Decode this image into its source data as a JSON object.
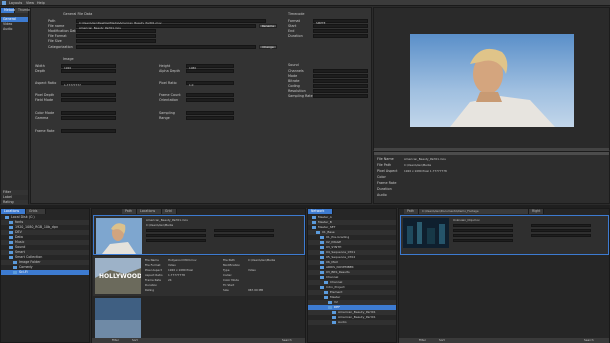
{
  "menubar": {
    "items": [
      "Layouts",
      "View",
      "Help"
    ]
  },
  "left_tabs": [
    "Metadata",
    "Thumbnails"
  ],
  "left_list": [
    "General",
    "Video",
    "Audio"
  ],
  "left_bottom": [
    "Filter",
    "Label",
    "Rating"
  ],
  "general": {
    "section": "General File Data",
    "labels": [
      "Path",
      "File name",
      "Modification Date",
      "File Format",
      "File Size",
      "Categorization"
    ],
    "values": [
      "C:\\Users\\dev\\Desktop\\Media\\American_Beauty_Part01.mov",
      "American_Beauty_Part01.mov",
      "",
      "",
      "",
      ""
    ],
    "button1": "Rename",
    "button2": "Change"
  },
  "image": {
    "section": "Image",
    "left_labels": [
      "Width",
      "Depth",
      "Aspect Ratio",
      "Pixel Depth",
      "Field Mode",
      "Color Mode",
      "Gamma",
      "Frame Rate"
    ],
    "left_values": [
      "1920",
      "",
      "1.77777777",
      "",
      "",
      "",
      "",
      ""
    ],
    "right_labels": [
      "Height",
      "Alpha Depth",
      "Pixel Ratio",
      "Frame Count",
      "Orientation",
      "Sampling",
      "Range"
    ],
    "right_values": [
      "1080",
      "",
      "1.0",
      "",
      "",
      "",
      ""
    ]
  },
  "timecode": {
    "section": "Timecode",
    "labels": [
      "Format",
      "Start",
      "End",
      "Duration"
    ],
    "values": [
      "SMPTE",
      "",
      "",
      ""
    ]
  },
  "sound": {
    "section": "Sound",
    "labels": [
      "Channels",
      "Mode",
      "Bitrate",
      "Coding",
      "Resolution",
      "Sampling Rate"
    ]
  },
  "info": {
    "labels": [
      "File Name",
      "File Path",
      "Pixel Aspect",
      "Color",
      "Frame Rate",
      "Duration",
      "Audio"
    ],
    "values": [
      "American_Beauty_Part01.mov",
      "C:\\Users\\dev\\Media",
      "1920 x 1080 Pixel  1.77777778",
      "",
      "",
      "",
      ""
    ]
  },
  "bottom_left": {
    "tabs": [
      "Locations",
      "Grids"
    ],
    "tree": [
      "Local Disk (C:)",
      "fonts",
      "1920_1080_RGB_10b_dpx",
      "DEV",
      "Data",
      "Music",
      "Sound",
      "Smart",
      "Smart Collection",
      "Image Folder",
      "Comedy",
      "Sci-Fi"
    ]
  },
  "bottom_mid": {
    "tabs": [
      "Path",
      "Locations",
      "Grid"
    ],
    "clip1": {
      "name": "American_Beauty_Part01.mov",
      "path": "C:\\Users\\dev\\Media"
    },
    "clip2": {
      "name": "Hollywood.mov",
      "labels": [
        "File Name",
        "File Format",
        "Pixel Aspect",
        "Aspect Ratio",
        "Frame Rate",
        "Duration",
        "Rating"
      ],
      "values": [
        "Hollywood MOV.mov",
        "Video",
        "1920 x 1080 Pixel",
        "1.77777778",
        "24",
        "",
        ""
      ],
      "labels2": [
        "File Path",
        "Modification",
        "Type",
        "Codec",
        "Color Mode",
        "TC Start",
        "Size"
      ],
      "values2": [
        "C:\\Users\\dev\\Media",
        "",
        "Video",
        "",
        "",
        "",
        "967.00 MB"
      ]
    },
    "footer": [
      "Filter",
      "Sort",
      "Search"
    ]
  },
  "bottom_right_tree": {
    "tabs": [
      "Network"
    ],
    "items": [
      "Master_A",
      "Master_B",
      "Master_SET",
      "01_Base",
      "01_Pre-Grading",
      "02_IMAGE",
      "03_SYNTH",
      "04_Sequence_0701",
      "05_Sequence_0702",
      "06_MAX",
      "ARRIS_NOVEMBER",
      "03_BRS_Results",
      "Channel",
      "Channel",
      "Intro_Project",
      "Element",
      "Master",
      "V2",
      "DEF",
      "American_Beauty_Part01",
      "American_Beauty_Part01",
      "Audio"
    ]
  },
  "bottom_right_grid": {
    "tabs": [
      "Path",
      "C:\\Users\\dev\\Documents\\Demo_Footage",
      "Right"
    ],
    "clip": {
      "name": "Unknown_Clip.mov"
    },
    "footer": [
      "Filter",
      "Sort",
      "Search"
    ]
  }
}
